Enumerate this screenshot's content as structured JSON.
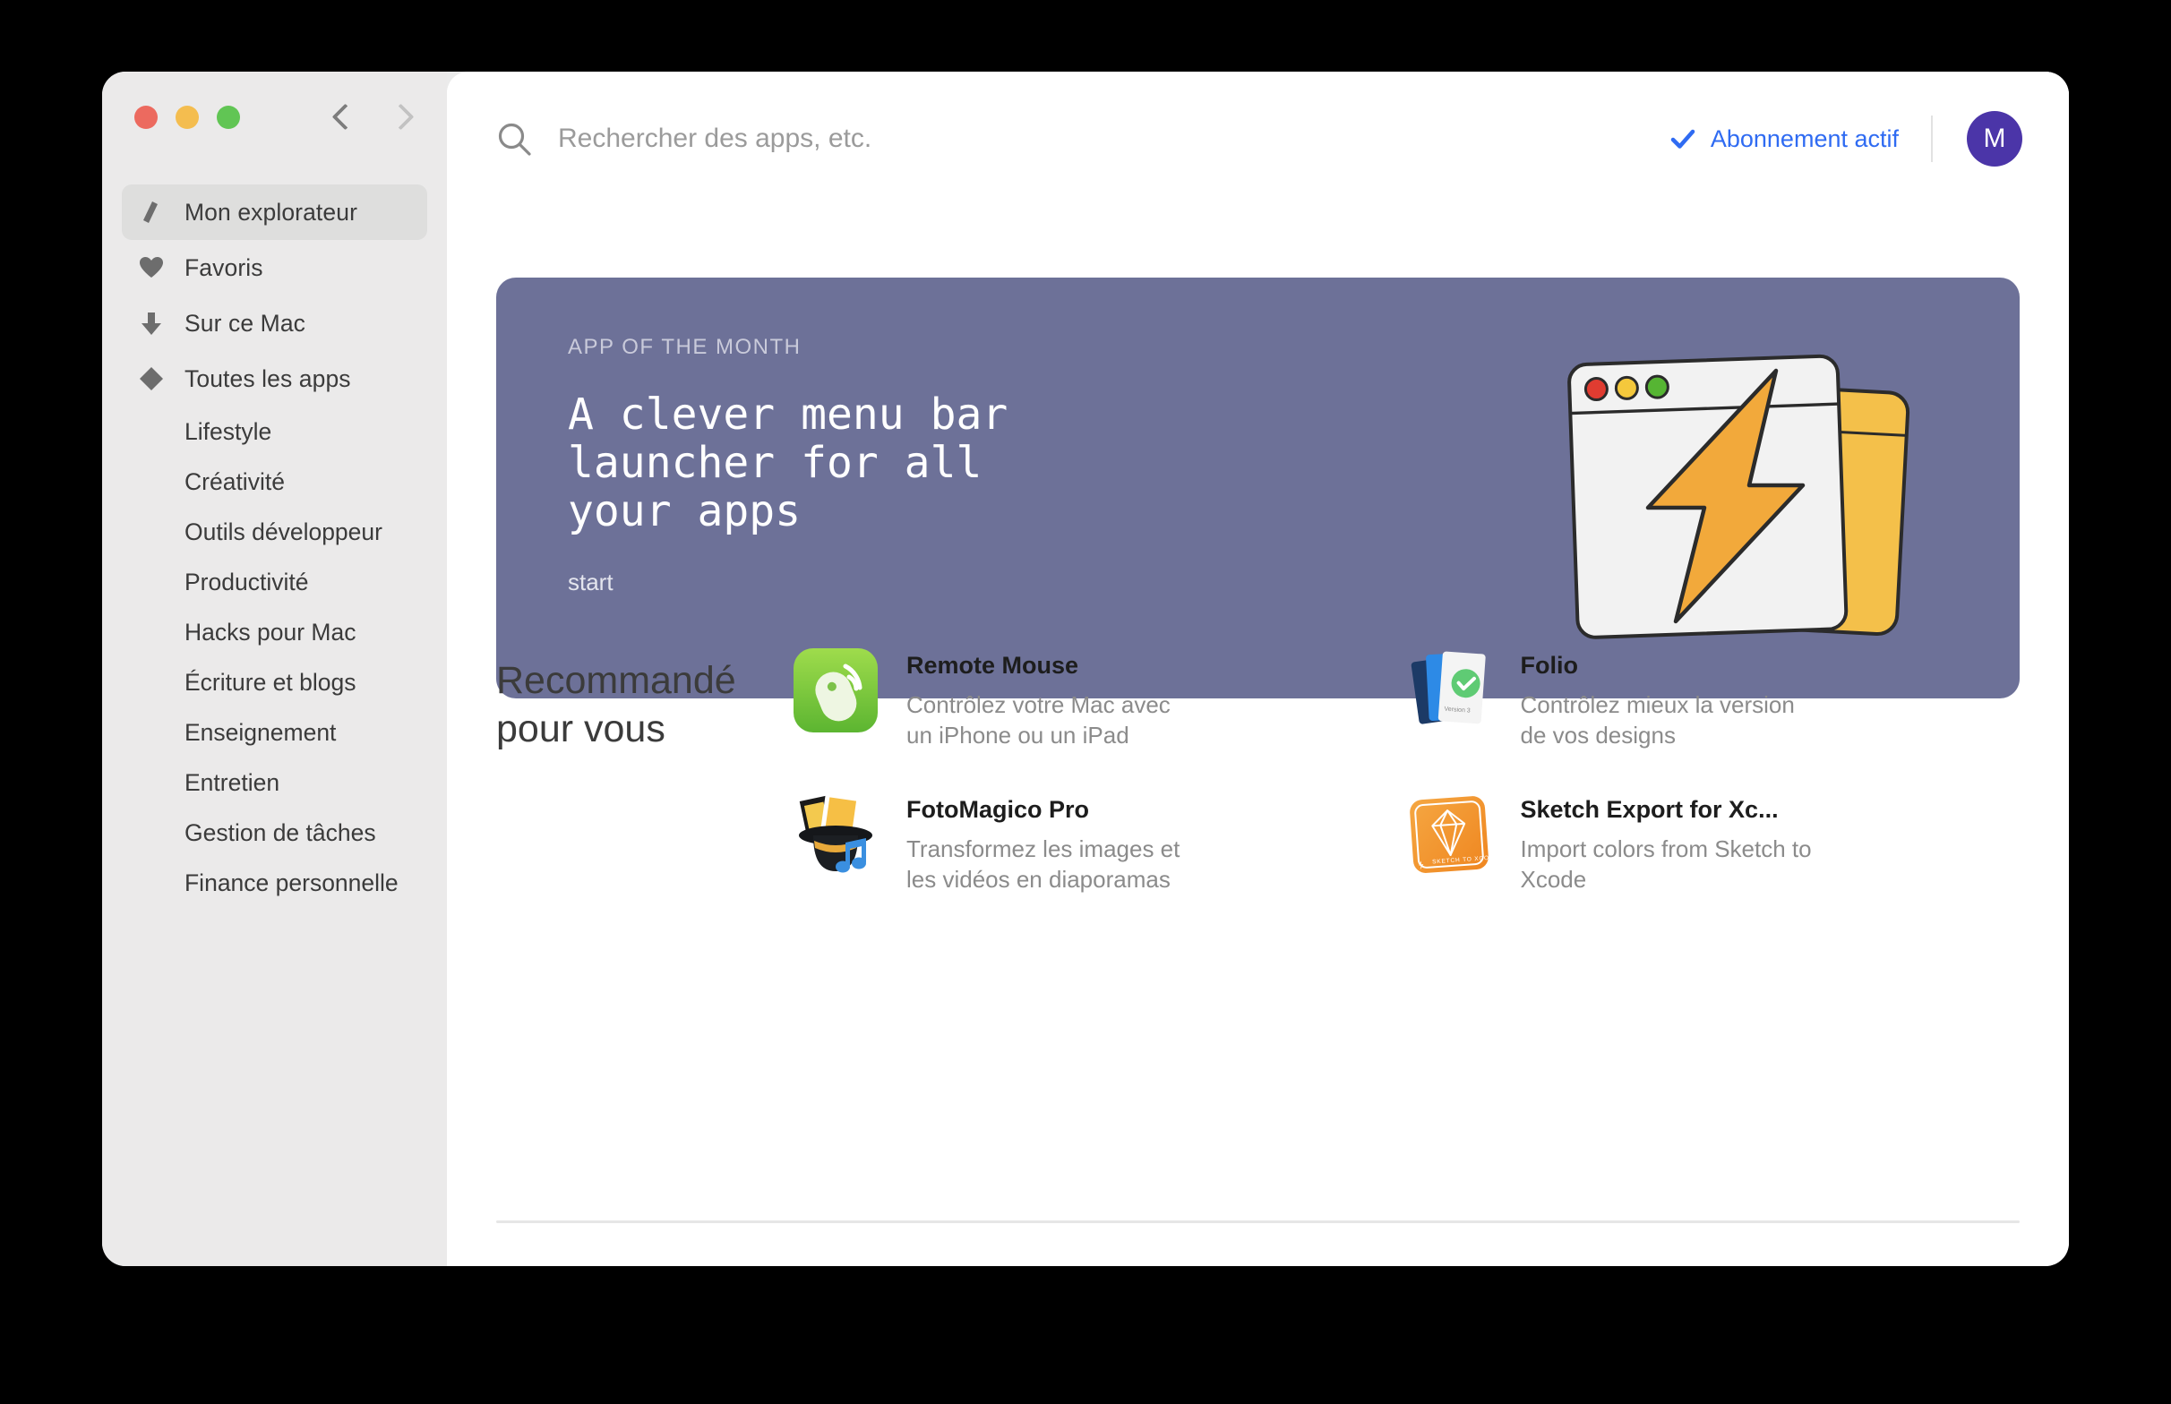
{
  "window": {
    "traffic_lights": [
      "close",
      "minimize",
      "maximize"
    ],
    "nav": {
      "back": "‹",
      "forward": "›"
    }
  },
  "sidebar": {
    "primary_items": [
      {
        "label": "Mon explorateur",
        "icon": "explorer-icon",
        "active": true
      },
      {
        "label": "Favoris",
        "icon": "heart-icon",
        "active": false
      },
      {
        "label": "Sur ce Mac",
        "icon": "download-arrow-icon",
        "active": false
      },
      {
        "label": "Toutes les apps",
        "icon": "diamond-icon",
        "active": false
      }
    ],
    "categories": [
      "Lifestyle",
      "Créativité",
      "Outils développeur",
      "Productivité",
      "Hacks pour Mac",
      "Écriture et blogs",
      "Enseignement",
      "Entretien",
      "Gestion de tâches",
      "Finance personnelle"
    ]
  },
  "header": {
    "search": {
      "placeholder": "Rechercher des apps, etc.",
      "value": ""
    },
    "subscription_status": "Abonnement actif",
    "subscription_color": "#2f6bf2",
    "avatar_initial": "M",
    "avatar_color": "#4b35a8"
  },
  "carousel": {
    "peek_left_color": "#f8d2b6",
    "peek_right_color": "#9a6a80",
    "hero": {
      "eyebrow": "APP OF THE MONTH",
      "title": "A clever menu bar\nlauncher for all\nyour apps",
      "cta": "start",
      "background_color": "#6d7198",
      "artwork": "window-lightning-bolt-icon"
    }
  },
  "recommended": {
    "heading": "Recommandé\npour vous",
    "apps": [
      {
        "name": "Remote Mouse",
        "description": "Contrôlez votre Mac avec un iPhone ou un iPad",
        "icon": "remote-mouse-icon"
      },
      {
        "name": "Folio",
        "description": "Contrôlez mieux la version de vos designs",
        "icon": "folio-cards-icon",
        "icon_caption": "Version 3"
      },
      {
        "name": "FotoMagico Pro",
        "description": "Transformez les images et les vidéos en diaporamas",
        "icon": "fotomagico-hat-icon"
      },
      {
        "name": "Sketch Export for Xc...",
        "description": "Import colors from Sketch to Xcode",
        "icon": "sketch-gem-icon",
        "icon_caption": "SKETCH TO XCODE"
      }
    ]
  }
}
